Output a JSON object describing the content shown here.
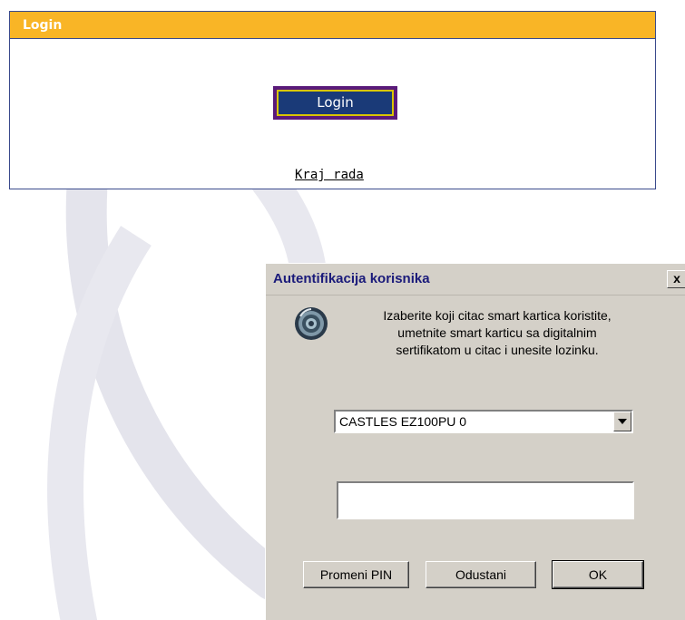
{
  "login_panel": {
    "header_title": "Login",
    "login_button_label": "Login",
    "logout_link": "Kraj rada"
  },
  "dialog": {
    "title": "Autentifikacija korisnika",
    "close_label": "x",
    "instructions": [
      "Izaberite koji citac smart kartica koristite,",
      "umetnite smart karticu sa digitalnim",
      "sertifikatom u citac i unesite lozinku."
    ],
    "reader_select": {
      "selected_value": "CASTLES EZ100PU 0"
    },
    "pin_input": {
      "value": "",
      "placeholder": ""
    },
    "buttons": {
      "change_pin": "Promeni PIN",
      "cancel": "Odustani",
      "ok": "OK"
    }
  },
  "colors": {
    "header_orange": "#f9b526",
    "button_navy": "#1a3a78",
    "button_outer_purple": "#5a1a7a",
    "button_border_yellow": "#d9c400",
    "dialog_gray": "#d4d0c8",
    "title_text_navy": "#1a1a7a"
  },
  "icons": {
    "info": "smart-card-reader-icon",
    "close": "close-icon",
    "dropdown": "chevron-down-icon"
  }
}
